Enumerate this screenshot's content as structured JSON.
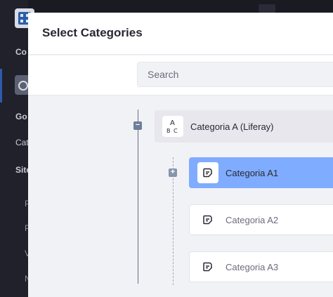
{
  "modal": {
    "title": "Select Categories"
  },
  "search": {
    "placeholder": "Search",
    "value": ""
  },
  "background": {
    "labels": [
      "Co",
      "Go",
      "Cat",
      "Site",
      "P",
      "P",
      "V",
      "N"
    ]
  },
  "tree": {
    "root": {
      "label": "Categoria A (Liferay)",
      "icon": "vocabulary-abc-icon",
      "expanded": true
    },
    "children": [
      {
        "label": "Categoria A1",
        "icon": "category-tag-icon",
        "selected": true,
        "has_children": true
      },
      {
        "label": "Categoria A2",
        "icon": "category-tag-icon",
        "selected": false
      },
      {
        "label": "Categoria A3",
        "icon": "category-tag-icon",
        "selected": false
      }
    ]
  },
  "colors": {
    "selected": "#80acff",
    "root_node_bg": "#e7e7ed",
    "modal_bg": "#f1f2f5",
    "app_bg": "#1c1d27"
  }
}
